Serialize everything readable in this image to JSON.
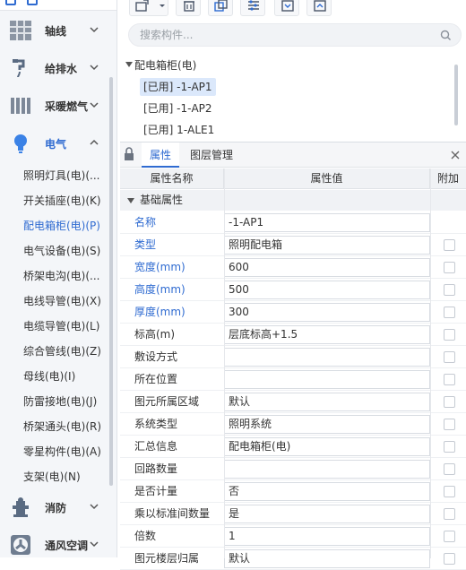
{
  "nav": {
    "categories_top": [
      {
        "label": "轴线",
        "icon": "grid-axis-icon"
      },
      {
        "label": "给排水",
        "icon": "faucet-icon"
      },
      {
        "label": "采暖燃气",
        "icon": "radiator-icon"
      },
      {
        "label": "电气",
        "icon": "lightbulb-icon"
      }
    ],
    "electrical_items": [
      "照明灯具(电)(...",
      "开关插座(电)(K)",
      "配电箱柜(电)(P)",
      "电气设备(电)(S)",
      "桥架电沟(电)(...",
      "电线导管(电)(X)",
      "电缆导管(电)(L)",
      "综合管线(电)(Z)",
      "母线(电)(I)",
      "防雷接地(电)(J)",
      "桥架通头(电)(R)",
      "零星构件(电)(A)",
      "支架(电)(N)"
    ],
    "categories_bottom": [
      {
        "label": "消防",
        "icon": "fire-hydrant-icon"
      },
      {
        "label": "通风空调",
        "icon": "fan-icon"
      }
    ]
  },
  "toolbar": {
    "icons": [
      "new-component-icon",
      "dropdown-arrow-icon",
      "delete-icon",
      "copy-icon",
      "layer-settings-icon",
      "export-icon",
      "import-icon"
    ]
  },
  "search": {
    "placeholder": "搜索构件...",
    "value": ""
  },
  "tree": {
    "root": "配电箱柜(电)",
    "items": [
      "[已用] -1-AP1",
      "[已用] -1-AP2",
      "[已用] 1-ALE1"
    ]
  },
  "props": {
    "tabs": [
      "属性",
      "图层管理"
    ],
    "headers": [
      "属性名称",
      "属性值",
      "附加"
    ],
    "group": "基础属性",
    "rows": [
      {
        "name": "名称",
        "value": "-1-AP1",
        "blue": true,
        "check": false
      },
      {
        "name": "类型",
        "value": "照明配电箱",
        "blue": true,
        "check": true
      },
      {
        "name": "宽度(mm)",
        "value": "600",
        "blue": true,
        "check": true
      },
      {
        "name": "高度(mm)",
        "value": "500",
        "blue": true,
        "check": true
      },
      {
        "name": "厚度(mm)",
        "value": "300",
        "blue": true,
        "check": true
      },
      {
        "name": "标高(m)",
        "value": "层底标高+1.5",
        "blue": false,
        "check": true
      },
      {
        "name": "敷设方式",
        "value": "",
        "blue": false,
        "check": true
      },
      {
        "name": "所在位置",
        "value": "",
        "blue": false,
        "check": true
      },
      {
        "name": "图元所属区域",
        "value": "默认",
        "blue": false,
        "check": true
      },
      {
        "name": "系统类型",
        "value": "照明系统",
        "blue": false,
        "check": true
      },
      {
        "name": "汇总信息",
        "value": "配电箱柜(电)",
        "blue": false,
        "check": true
      },
      {
        "name": "回路数量",
        "value": "",
        "blue": false,
        "check": true
      },
      {
        "name": "是否计量",
        "value": "否",
        "blue": false,
        "check": true
      },
      {
        "name": "乘以标准间数量",
        "value": "是",
        "blue": false,
        "check": true
      },
      {
        "name": "倍数",
        "value": "1",
        "blue": false,
        "check": true
      },
      {
        "name": "图元楼层归属",
        "value": "默认",
        "blue": false,
        "check": true
      }
    ]
  },
  "colors": {
    "accent": "#2f6bd1",
    "selected_bg": "#dbe8fb"
  }
}
